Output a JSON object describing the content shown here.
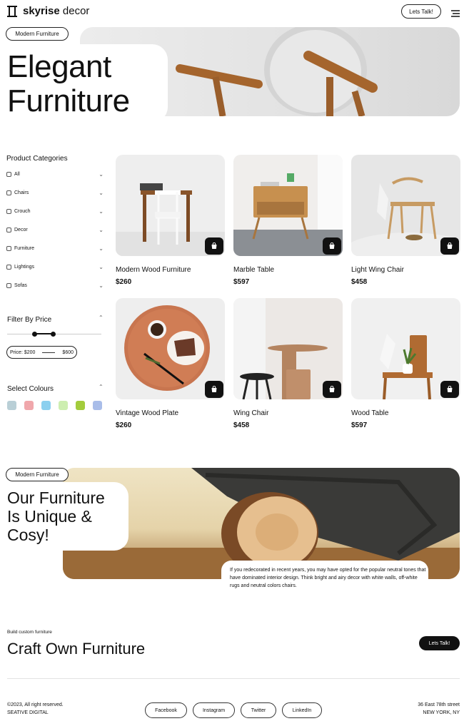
{
  "header": {
    "brand_bold": "skyrise",
    "brand_light": " decor",
    "cta": "Lets Talk!"
  },
  "hero": {
    "badge": "Modern Furniture",
    "title_line1": "Elegant",
    "title_line2": "Furniture"
  },
  "sidebar": {
    "categories_title": "Product Categories",
    "categories": [
      "All",
      "Chairs",
      "Crouch",
      "Decor",
      "Furniture",
      "Lightings",
      "Sofas"
    ],
    "price_title": "Filter By Price",
    "price_label": "Price: $200",
    "price_max": "$600",
    "colours_title": "Select Colours",
    "colours": [
      "#b9cfd6",
      "#f0a7ab",
      "#8cd0ef",
      "#cdeeb0",
      "#a3cc3c",
      "#a9bde9"
    ]
  },
  "products": [
    {
      "name": "Modern Wood Furniture",
      "price": "$260"
    },
    {
      "name": "Marble Table",
      "price": "$597"
    },
    {
      "name": "Light Wing Chair",
      "price": "$458"
    },
    {
      "name": "Vintage Wood Plate",
      "price": "$260"
    },
    {
      "name": "Wing Chair",
      "price": "$458"
    },
    {
      "name": "Wood Table",
      "price": "$597"
    }
  ],
  "feature": {
    "badge": "Modern Furniture",
    "title_line1": "Our Furniture",
    "title_line2": "Is Unique &",
    "title_line3": "Cosy!",
    "body": "If you redecorated in recent years, you may have opted for the popular neutral tones that have dominated interior design. Think bright and airy decor with white walls, off-white rugs and neutral colors chairs."
  },
  "craft": {
    "eyebrow": "Build custom furniture",
    "title": "Craft Own Furniture",
    "cta": "Lets Talk!"
  },
  "footer": {
    "copyright": "©2023, All right reserved.",
    "company": "SEATIVE DIGITAL",
    "socials": [
      "Facebook",
      "Instagram",
      "Twitter",
      "LinkedIn"
    ],
    "address_line1": "36 East 78th street",
    "address_line2": "NEW YORK, NY"
  }
}
